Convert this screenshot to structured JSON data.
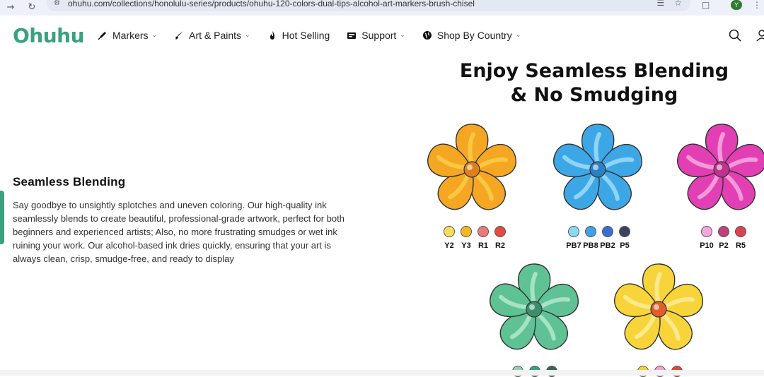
{
  "browser": {
    "url": "ohuhu.com/collections/honolulu-series/products/ohuhu-120-colors-dual-tips-alcohol-art-markers-brush-chisel",
    "profile_initial": "Y"
  },
  "header": {
    "logo": "Ohuhu",
    "nav": [
      {
        "label": "Markers",
        "icon": "marker-icon",
        "has_dropdown": true
      },
      {
        "label": "Art & Paints",
        "icon": "paintbrush-icon",
        "has_dropdown": true
      },
      {
        "label": "Hot Selling",
        "icon": "flame-icon",
        "has_dropdown": false
      },
      {
        "label": "Support",
        "icon": "support-icon",
        "has_dropdown": true
      },
      {
        "label": "Shop By Country",
        "icon": "globe-icon",
        "has_dropdown": true
      }
    ],
    "icons": [
      "search-icon",
      "account-icon"
    ]
  },
  "feature": {
    "title": "Seamless Blending",
    "body": "Say goodbye to unsightly splotches and uneven coloring. Our high-quality ink seamlessly blends to create beautiful, professional-grade artwork, perfect for both beginners and experienced artists; Also, no more frustrating smudges or wet ink ruining your work. Our alcohol-based ink dries quickly, ensuring that your art is always clean, crisp, smudge-free, and ready to display"
  },
  "headline": {
    "line1": "Enjoy Seamless Blending",
    "line2": "& No Smudging"
  },
  "flowers": [
    {
      "name": "orange",
      "petal": "#f5a623",
      "inner": "#f7c843",
      "center": "#e0801a",
      "swatches": [
        {
          "code": "Y2",
          "color": "#f8dc5a"
        },
        {
          "code": "Y3",
          "color": "#f3b81e"
        },
        {
          "code": "R1",
          "color": "#e87b7b"
        },
        {
          "code": "R2",
          "color": "#e34b3f"
        }
      ]
    },
    {
      "name": "blue",
      "petal": "#3da7e6",
      "inner": "#8fd4f5",
      "center": "#2c7fc2",
      "swatches": [
        {
          "code": "PB7",
          "color": "#86dbf3"
        },
        {
          "code": "PB8",
          "color": "#3ba3e8"
        },
        {
          "code": "PB2",
          "color": "#3a6fd0"
        },
        {
          "code": "P5",
          "color": "#3e4060"
        }
      ]
    },
    {
      "name": "pink",
      "petal": "#e23fb4",
      "inner": "#f59ad8",
      "center": "#c0328c",
      "swatches": [
        {
          "code": "P10",
          "color": "#f2a6dc"
        },
        {
          "code": "P2",
          "color": "#c0407e"
        },
        {
          "code": "R5",
          "color": "#d84453"
        }
      ]
    },
    {
      "name": "green",
      "petal": "#5fc294",
      "inner": "#a6e2c4",
      "center": "#3d8f6b",
      "swatches": [
        {
          "code": "",
          "color": "#8fd3b0"
        },
        {
          "code": "",
          "color": "#3aa08a"
        },
        {
          "code": "",
          "color": "#2e6b55"
        }
      ]
    },
    {
      "name": "yellow",
      "petal": "#f7d43a",
      "inner": "#fbe98a",
      "center": "#e35d2a",
      "swatches": [
        {
          "code": "",
          "color": "#f4d22c"
        },
        {
          "code": "",
          "color": "#f2a3d8"
        },
        {
          "code": "",
          "color": "#e0483a"
        }
      ]
    }
  ]
}
